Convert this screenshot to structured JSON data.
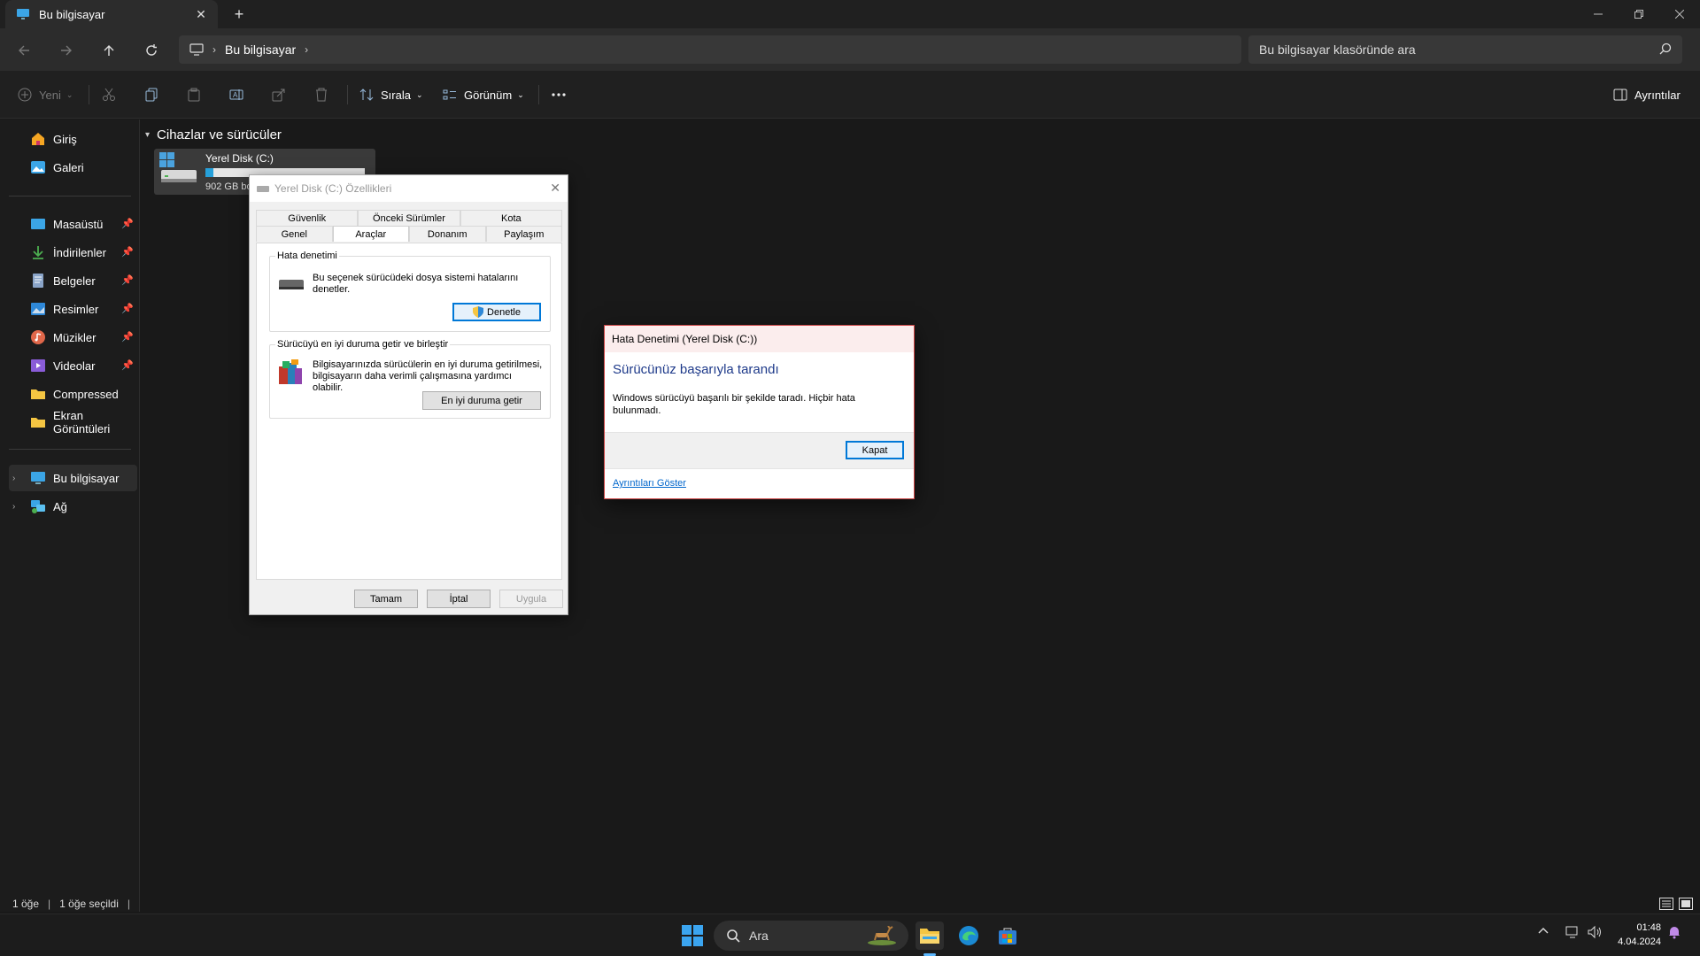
{
  "window": {
    "tab_title": "Bu bilgisayar",
    "tab_close": "✕",
    "new_tab": "+"
  },
  "address_bar": {
    "path_item": "Bu bilgisayar",
    "search_placeholder": "Bu bilgisayar klasöründe ara"
  },
  "command_bar": {
    "new_label": "Yeni",
    "sort_label": "Sırala",
    "view_label": "Görünüm",
    "details_label": "Ayrıntılar"
  },
  "sidebar": {
    "items": [
      {
        "label": "Giriş"
      },
      {
        "label": "Galeri"
      },
      {
        "label": "Masaüstü"
      },
      {
        "label": "İndirilenler"
      },
      {
        "label": "Belgeler"
      },
      {
        "label": "Resimler"
      },
      {
        "label": "Müzikler"
      },
      {
        "label": "Videolar"
      },
      {
        "label": "Compressed"
      },
      {
        "label": "Ekran Görüntüleri"
      },
      {
        "label": "Bu bilgisayar"
      },
      {
        "label": "Ağ"
      }
    ]
  },
  "main": {
    "section_title": "Cihazlar ve sürücüler",
    "drive": {
      "name": "Yerel Disk (C:)",
      "size_text": "902 GB boş",
      "used_fraction": 0.05
    }
  },
  "status_bar": {
    "item_count": "1 öğe",
    "selected_count": "1 öğe seçildi"
  },
  "properties_dialog": {
    "title": "Yerel Disk (C:) Özellikleri",
    "tabs_row1": [
      "Güvenlik",
      "Önceki Sürümler",
      "Kota"
    ],
    "tabs_row2": [
      "Genel",
      "Araçlar",
      "Donanım",
      "Paylaşım"
    ],
    "active_tab": "Araçlar",
    "error_check": {
      "group_title": "Hata denetimi",
      "text": "Bu seçenek sürücüdeki dosya sistemi hatalarını denetler.",
      "button": "Denetle"
    },
    "optimize": {
      "group_title": "Sürücüyü en iyi duruma getir ve birleştir",
      "text": "Bilgisayarınızda sürücülerin en iyi duruma getirilmesi, bilgisayarın daha verimli çalışmasına yardımcı olabilir.",
      "button": "En iyi duruma getir"
    },
    "ok_button": "Tamam",
    "cancel_button": "İptal",
    "apply_button": "Uygula"
  },
  "result_dialog": {
    "title": "Hata Denetimi (Yerel Disk (C:))",
    "heading": "Sürücünüz başarıyla tarandı",
    "message": "Windows sürücüyü başarılı bir şekilde taradı. Hiçbir hata bulunmadı.",
    "close_button": "Kapat",
    "details_link": "Ayrıntıları Göster"
  },
  "taskbar": {
    "search_placeholder": "Ara",
    "time": "01:48",
    "date": "4.04.2024"
  },
  "colors": {
    "accent": "#0078d7",
    "background": "#191919",
    "drive_bar": "#26a0da"
  }
}
